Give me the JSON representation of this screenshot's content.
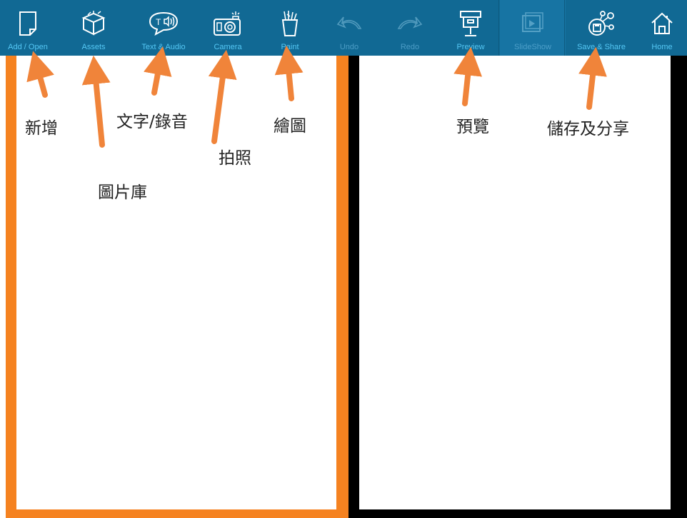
{
  "toolbar": {
    "items": [
      {
        "label": "Add / Open",
        "icon": "document-icon"
      },
      {
        "label": "Assets",
        "icon": "box-icon"
      },
      {
        "label": "Text & Audio",
        "icon": "speech-bubble-icon"
      },
      {
        "label": "Camera",
        "icon": "camera-icon"
      },
      {
        "label": "Paint",
        "icon": "paint-cup-icon"
      },
      {
        "label": "Undo",
        "icon": "undo-icon"
      },
      {
        "label": "Redo",
        "icon": "redo-icon"
      },
      {
        "label": "Preview",
        "icon": "projector-icon"
      },
      {
        "label": "SlideShow",
        "icon": "slideshow-icon"
      },
      {
        "label": "Save & Share",
        "icon": "share-network-icon"
      },
      {
        "label": "Home",
        "icon": "home-icon"
      }
    ],
    "colors": {
      "bar": "#116994",
      "label": "#55c8f5"
    }
  },
  "annotations": {
    "add": "新增",
    "assets": "圖片庫",
    "text_audio": "文字/錄音",
    "camera": "拍照",
    "paint": "繪圖",
    "preview": "預覽",
    "save_share": "儲存及分享",
    "arrow_color": "#f0843a"
  },
  "panels": {
    "left_border_color": "#f58220",
    "right_border_color": "#000000"
  }
}
